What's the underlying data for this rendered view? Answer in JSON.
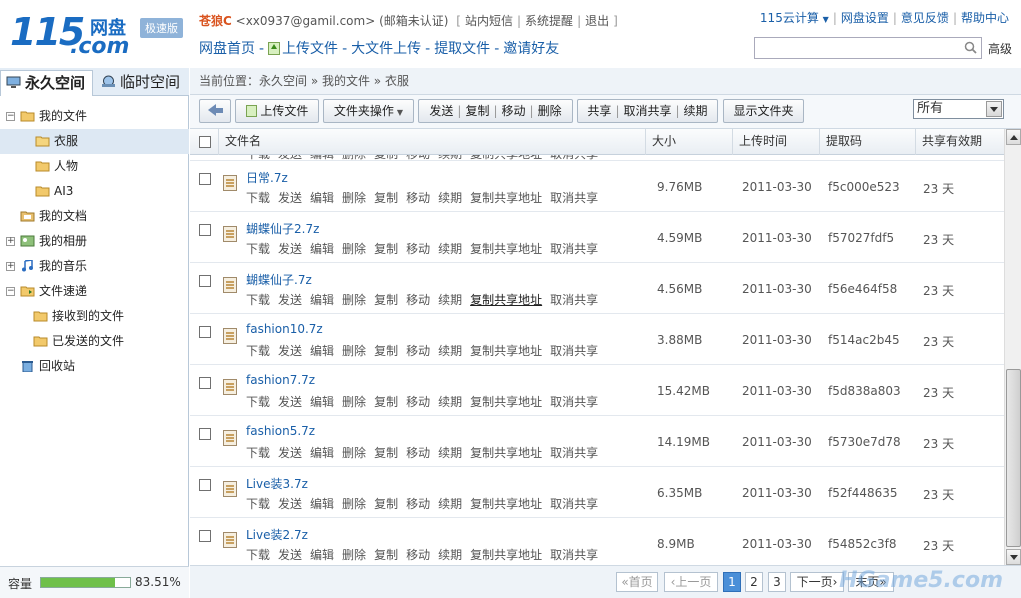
{
  "header": {
    "logo_num": "115",
    "logo_cn": "网盘",
    "logo_com": ".com",
    "logo_badge": "极速版",
    "username": "苍狼C",
    "email": "<xx0937@gamil.com>",
    "email_status": "(邮箱未认证)",
    "bracket_open": "[",
    "bracket_close": "]",
    "links": [
      "站内短信",
      "系统提醒",
      "退出"
    ],
    "nav": [
      "网盘首页",
      "上传文件",
      "大文件上传",
      "提取文件",
      "邀请好友"
    ],
    "top_right": [
      "115云计算",
      "网盘设置",
      "意见反馈",
      "帮助中心"
    ],
    "search_placeholder": "",
    "advanced": "高级"
  },
  "left": {
    "tabs": [
      "永久空间",
      "临时空间"
    ],
    "tree": [
      {
        "label": "我的文件",
        "expander": "−"
      },
      {
        "label": "衣服"
      },
      {
        "label": "人物"
      },
      {
        "label": "AI3"
      },
      {
        "label": "我的文档"
      },
      {
        "label": "我的相册",
        "expander": "+"
      },
      {
        "label": "我的音乐",
        "expander": "+"
      },
      {
        "label": "文件速递",
        "expander": "−"
      },
      {
        "label": "接收到的文件"
      },
      {
        "label": "已发送的文件"
      },
      {
        "label": "回收站"
      }
    ],
    "capacity_label": "容量",
    "capacity_value": 0.8351,
    "capacity_text": "83.51%"
  },
  "main": {
    "breadcrumb": "当前位置：永久空间 » 我的文件 » 衣服",
    "toolbar": {
      "upload": "上传文件",
      "folder_ops": "文件夹操作",
      "group1": [
        "发送",
        "复制",
        "移动",
        "删除"
      ],
      "group2": [
        "共享",
        "取消共享",
        "续期"
      ],
      "show_folders": "显示文件夹",
      "filter_value": "所有"
    },
    "columns": [
      "文件名",
      "大小",
      "上传时间",
      "提取码",
      "共享有效期"
    ],
    "row_actions": [
      "下载",
      "发送",
      "编辑",
      "删除",
      "复制",
      "移动",
      "续期",
      "复制共享地址",
      "取消共享"
    ],
    "files": [
      {
        "name": "日常.7z",
        "size": "9.76MB",
        "date": "2011-03-30",
        "code": "f5c000e523",
        "expiry": "23 天"
      },
      {
        "name": "蝴蝶仙子2.7z",
        "size": "4.59MB",
        "date": "2011-03-30",
        "code": "f57027fdf5",
        "expiry": "23 天"
      },
      {
        "name": "蝴蝶仙子.7z",
        "size": "4.56MB",
        "date": "2011-03-30",
        "code": "f56e464f58",
        "expiry": "23 天"
      },
      {
        "name": "fashion10.7z",
        "size": "3.88MB",
        "date": "2011-03-30",
        "code": "f514ac2b45",
        "expiry": "23 天"
      },
      {
        "name": "fashion7.7z",
        "size": "15.42MB",
        "date": "2011-03-30",
        "code": "f5d838a803",
        "expiry": "23 天"
      },
      {
        "name": "fashion5.7z",
        "size": "14.19MB",
        "date": "2011-03-30",
        "code": "f5730e7d78",
        "expiry": "23 天"
      },
      {
        "name": "Live装3.7z",
        "size": "6.35MB",
        "date": "2011-03-30",
        "code": "f52f448635",
        "expiry": "23 天"
      },
      {
        "name": "Live装2.7z",
        "size": "8.9MB",
        "date": "2011-03-30",
        "code": "f54852c3f8",
        "expiry": "23 天"
      }
    ],
    "pager": {
      "first": "«首页",
      "prev": "‹上一页",
      "pages": [
        "1",
        "2",
        "3"
      ],
      "next": "下一页›",
      "last": "末页»"
    },
    "watermark": "HGame5.com"
  }
}
